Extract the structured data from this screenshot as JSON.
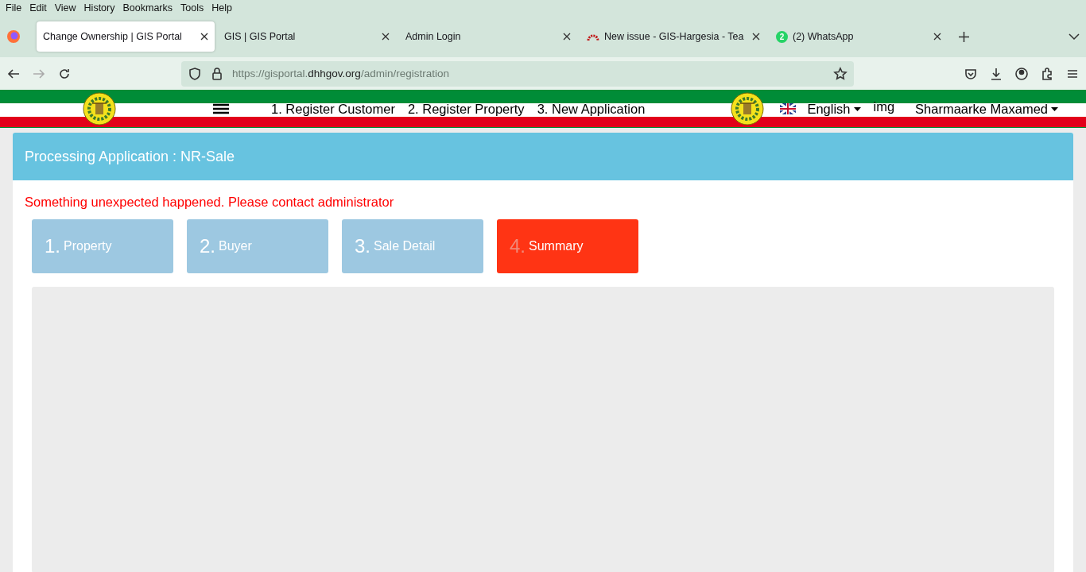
{
  "menu": [
    "File",
    "Edit",
    "View",
    "History",
    "Bookmarks",
    "Tools",
    "Help"
  ],
  "tabs": [
    {
      "title": "Change Ownership | GIS Portal",
      "selected": true,
      "kind": "plain"
    },
    {
      "title": "GIS | GIS Portal",
      "selected": false,
      "kind": "plain"
    },
    {
      "title": "Admin Login",
      "selected": false,
      "kind": "plain"
    },
    {
      "title": "New issue - GIS-Hargesia - Tea",
      "selected": false,
      "kind": "arc"
    },
    {
      "title": "(2) WhatsApp",
      "selected": false,
      "kind": "chat",
      "badge": "2"
    }
  ],
  "address": {
    "prefix": "https://gisportal.",
    "domain": "dhhgov.org",
    "path": "/admin/registration"
  },
  "header": {
    "nav": [
      "1. Register Customer",
      "2. Register Property",
      "3. New Application"
    ],
    "language": "English",
    "image_alt": "img",
    "user": "Sharmaarke Maxamed"
  },
  "panel": {
    "title": "Processing Application : NR-Sale",
    "error": "Something unexpected happened. Please contact administrator",
    "steps": [
      {
        "number": "1.",
        "label": "Property",
        "selected": false
      },
      {
        "number": "2.",
        "label": "Buyer",
        "selected": false
      },
      {
        "number": "3.",
        "label": "Sale Detail",
        "selected": false
      },
      {
        "number": "4.",
        "label": "Summary",
        "selected": true
      }
    ]
  }
}
